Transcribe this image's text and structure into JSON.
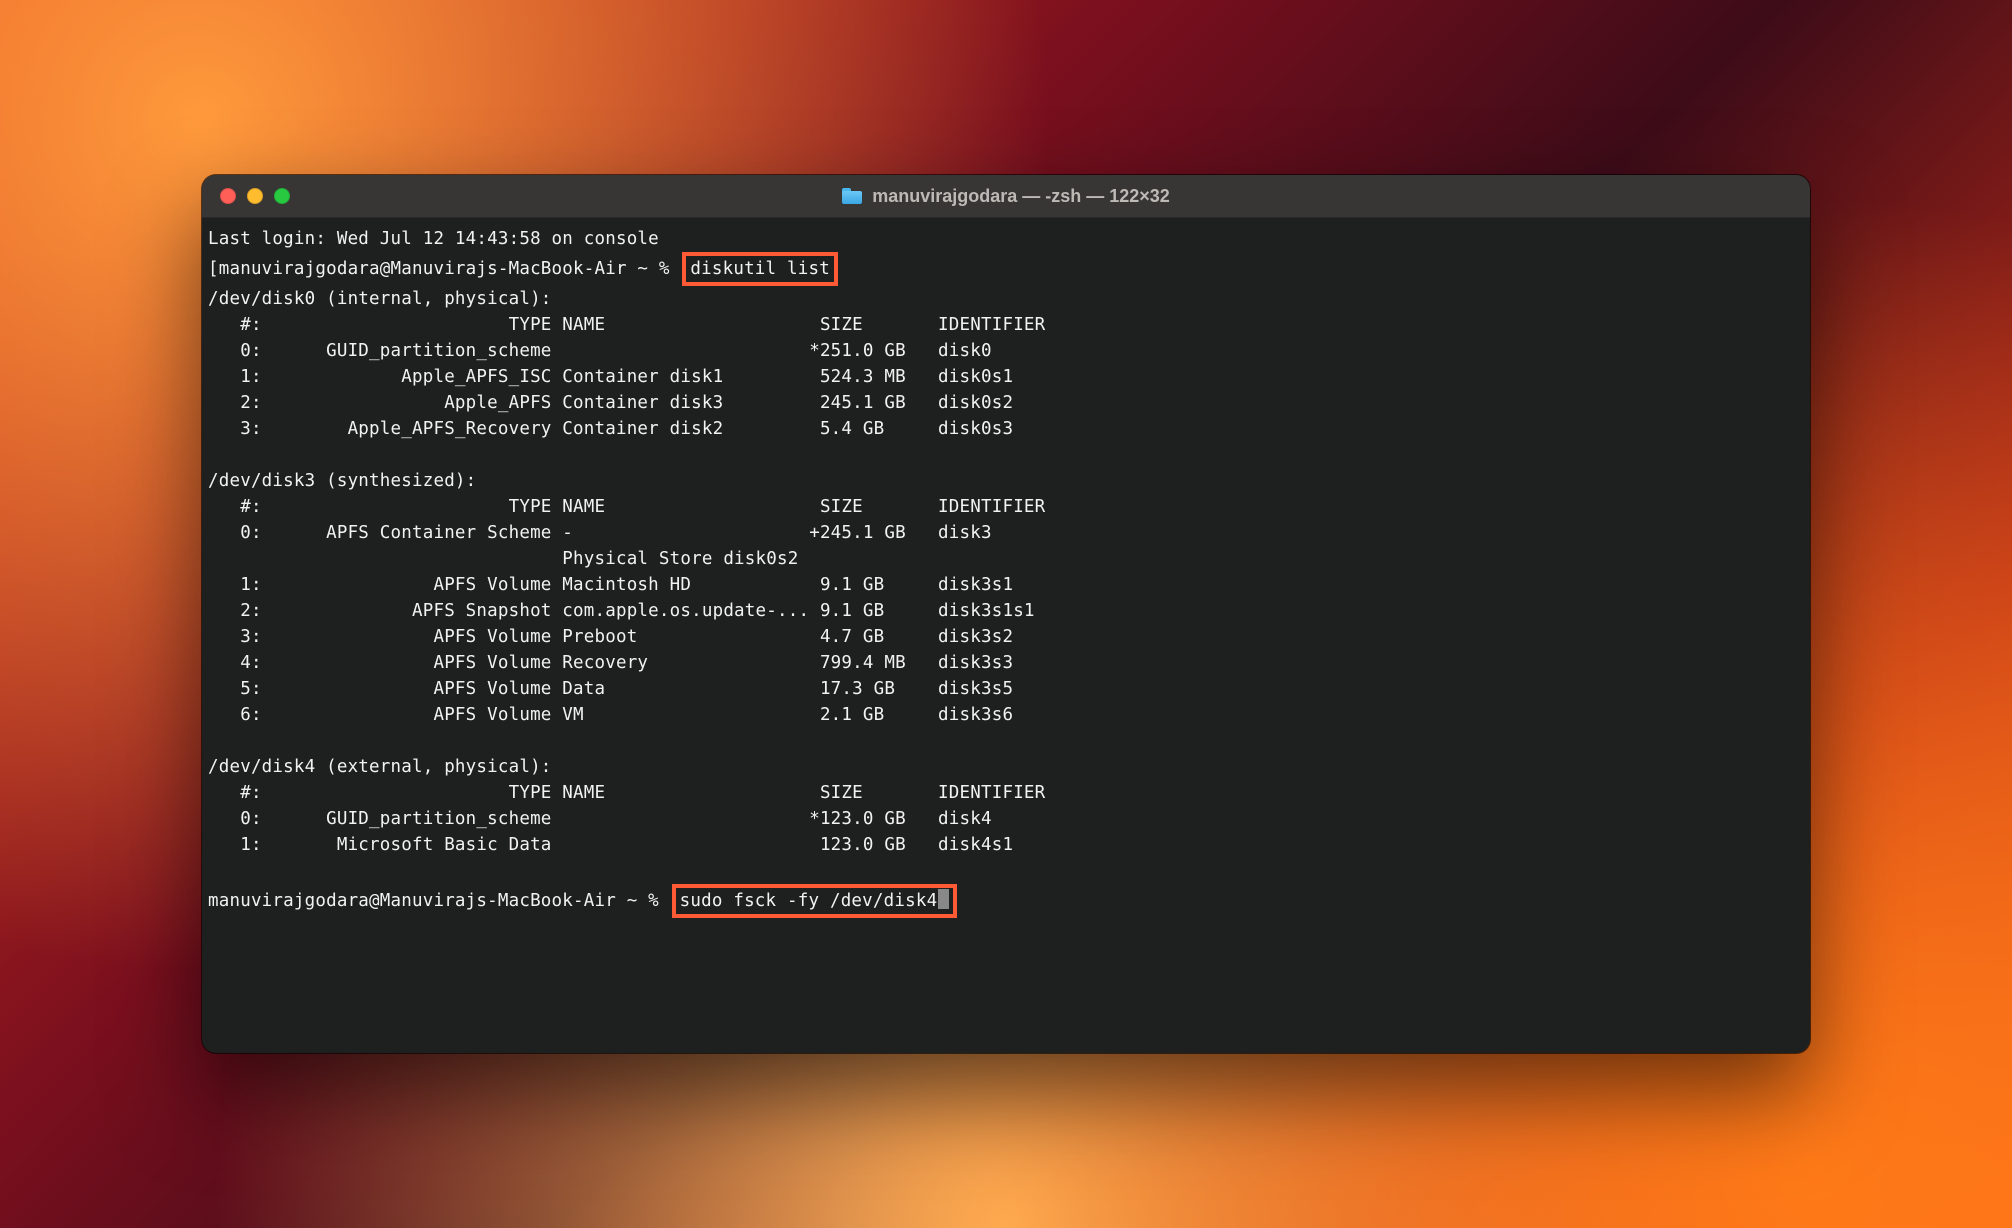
{
  "window": {
    "title": "manuvirajgodara — -zsh — 122×32",
    "traffic": {
      "close": "#ff5f57",
      "min": "#febc2e",
      "max": "#28c840"
    }
  },
  "session": {
    "last_login": "Last login: Wed Jul 12 14:43:58 on console",
    "prompt1_prefix": "[manuvirajgodara@Manuvirajs-MacBook-Air ~ % ",
    "cmd1": "diskutil list",
    "prompt2_prefix": "manuvirajgodara@Manuvirajs-MacBook-Air ~ % ",
    "cmd2": "sudo fsck -fy /dev/disk4"
  },
  "disk0": {
    "header": "/dev/disk0 (internal, physical):",
    "cols": "   #:                       TYPE NAME                    SIZE       IDENTIFIER",
    "r0": "   0:      GUID_partition_scheme                        *251.0 GB   disk0",
    "r1": "   1:             Apple_APFS_ISC Container disk1         524.3 MB   disk0s1",
    "r2": "   2:                 Apple_APFS Container disk3         245.1 GB   disk0s2",
    "r3": "   3:        Apple_APFS_Recovery Container disk2         5.4 GB     disk0s3"
  },
  "disk3": {
    "header": "/dev/disk3 (synthesized):",
    "cols": "   #:                       TYPE NAME                    SIZE       IDENTIFIER",
    "r0": "   0:      APFS Container Scheme -                      +245.1 GB   disk3",
    "rps": "                                 Physical Store disk0s2",
    "r1": "   1:                APFS Volume Macintosh HD            9.1 GB     disk3s1",
    "r2": "   2:              APFS Snapshot com.apple.os.update-... 9.1 GB     disk3s1s1",
    "r3": "   3:                APFS Volume Preboot                 4.7 GB     disk3s2",
    "r4": "   4:                APFS Volume Recovery                799.4 MB   disk3s3",
    "r5": "   5:                APFS Volume Data                    17.3 GB    disk3s5",
    "r6": "   6:                APFS Volume VM                      2.1 GB     disk3s6"
  },
  "disk4": {
    "header": "/dev/disk4 (external, physical):",
    "cols": "   #:                       TYPE NAME                    SIZE       IDENTIFIER",
    "r0": "   0:      GUID_partition_scheme                        *123.0 GB   disk4",
    "r1": "   1:       Microsoft Basic Data                         123.0 GB   disk4s1"
  }
}
